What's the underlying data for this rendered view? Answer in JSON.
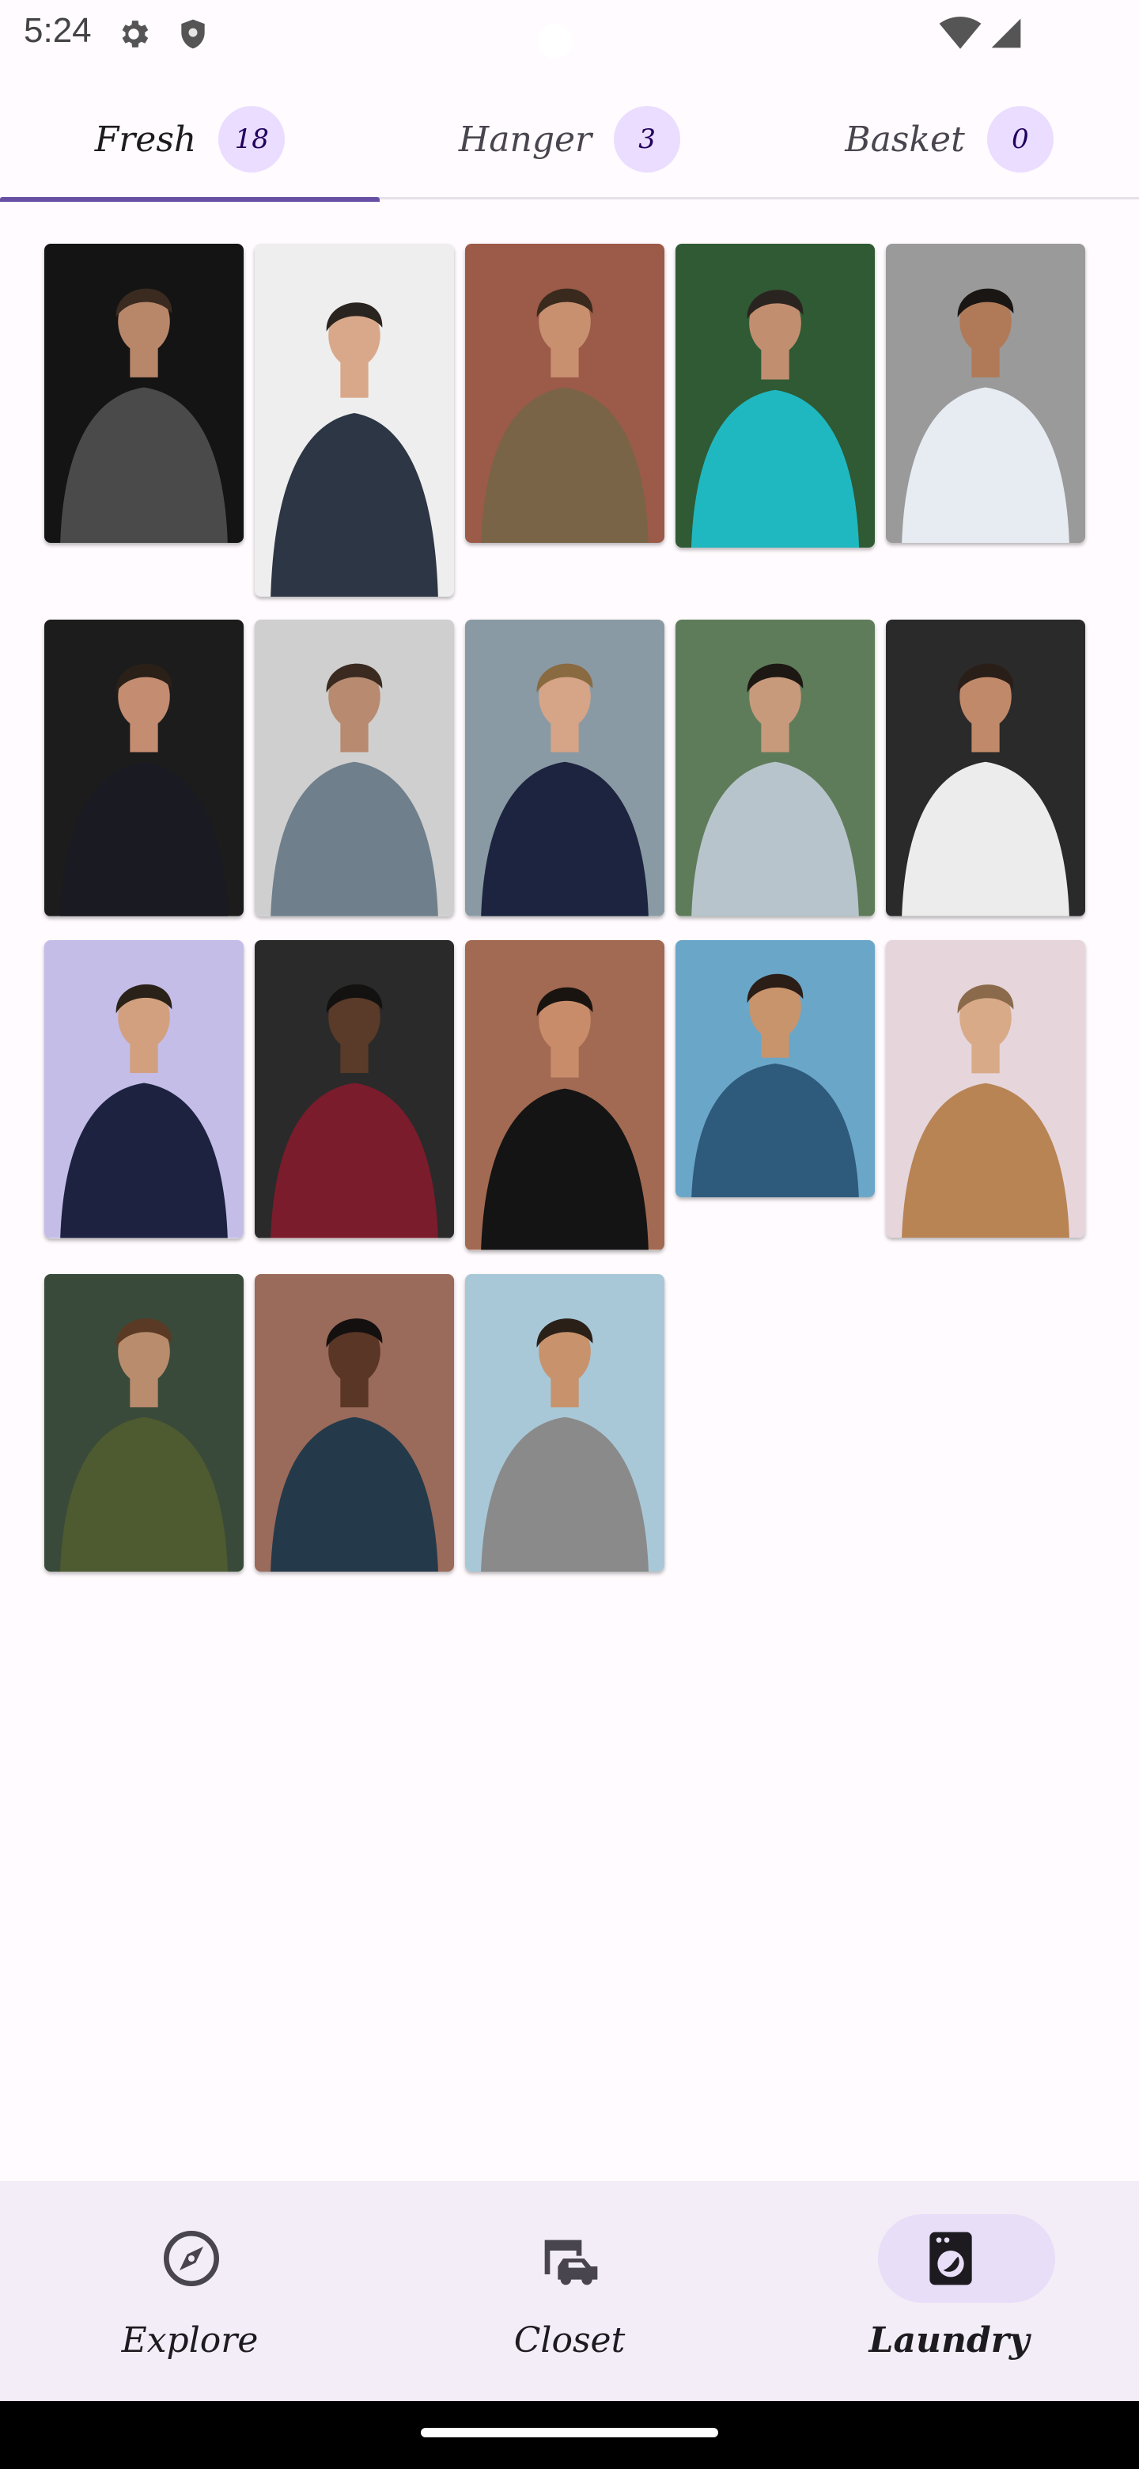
{
  "status_bar": {
    "time": "5:24",
    "left_icons": [
      "gear-icon",
      "shield-icon"
    ],
    "right_icons": [
      "wifi-icon",
      "cell-signal-icon"
    ]
  },
  "tabs": [
    {
      "label": "Fresh",
      "count": "18",
      "selected": true
    },
    {
      "label": "Hanger",
      "count": "3",
      "selected": false
    },
    {
      "label": "Basket",
      "count": "0",
      "selected": false
    }
  ],
  "photos": [
    {
      "name": "man-grey-knit-sweater",
      "bg": "#141414",
      "skin": "#b8876a",
      "hair": "#3a2a20",
      "shirt": "#4a4a4a"
    },
    {
      "name": "man-glasses-arms-crossed",
      "bg": "#eeeeee",
      "skin": "#d9a88a",
      "hair": "#2a2420",
      "shirt": "#2c3644"
    },
    {
      "name": "man-brown-jacket-brick-wall",
      "bg": "#9c5a48",
      "skin": "#c99070",
      "hair": "#3a2a1e",
      "shirt": "#7a6448"
    },
    {
      "name": "man-teal-shirt-plants",
      "bg": "#2f5a34",
      "skin": "#c28e70",
      "hair": "#2a2420",
      "shirt": "#1fb8c0"
    },
    {
      "name": "man-smiling-white-tee",
      "bg": "#9a9a9a",
      "skin": "#b07a58",
      "hair": "#1a1614",
      "shirt": "#e6ecf2"
    },
    {
      "name": "man-dark-suit-red-tie",
      "bg": "#1c1c1c",
      "skin": "#c48c70",
      "hair": "#2a2018",
      "shirt": "#1a1a22"
    },
    {
      "name": "man-skateboarding-beach",
      "bg": "#cfcfcf",
      "skin": "#b88a70",
      "hair": "#3a2a20",
      "shirt": "#6f7f8c"
    },
    {
      "name": "man-navy-suit-walkway",
      "bg": "#8a9aa4",
      "skin": "#d6a486",
      "hair": "#8a6a40",
      "shirt": "#1c2440"
    },
    {
      "name": "man-grey-tee-outdoors",
      "bg": "#5f7c5a",
      "skin": "#c89a7c",
      "hair": "#1e1814",
      "shirt": "#b8c4cc"
    },
    {
      "name": "man-white-tee-dark-backdrop",
      "bg": "#2a2a2a",
      "skin": "#c08a6a",
      "hair": "#2a1e18",
      "shirt": "#ececec"
    },
    {
      "name": "man-navy-shirt-lavender",
      "bg": "#c4bde8",
      "skin": "#d2a07e",
      "hair": "#2a2218",
      "shirt": "#1c2240"
    },
    {
      "name": "man-red-sweater-sunglasses",
      "bg": "#2a2a2a",
      "skin": "#5a3a28",
      "hair": "#141210",
      "shirt": "#7a1c2c"
    },
    {
      "name": "man-black-suit-street",
      "bg": "#a26a52",
      "skin": "#c88c6a",
      "hair": "#1a1410",
      "shirt": "#141414"
    },
    {
      "name": "man-denim-jacket-city",
      "bg": "#6aa6c8",
      "skin": "#c8946c",
      "hair": "#2a1e16",
      "shirt": "#2e5a7c"
    },
    {
      "name": "man-tan-blazer-stool",
      "bg": "#e6d6dc",
      "skin": "#d8aa88",
      "hair": "#8a6a4a",
      "shirt": "#b88454"
    },
    {
      "name": "man-olive-tee-beard",
      "bg": "#3a4a3a",
      "skin": "#b88c6c",
      "hair": "#5a3a24",
      "shirt": "#4e5a30"
    },
    {
      "name": "man-laughing-patterned-shirt",
      "bg": "#9a6a5a",
      "skin": "#5a3626",
      "hair": "#141010",
      "shirt": "#243a4a"
    },
    {
      "name": "man-sitting-rocks-backpack",
      "bg": "#a8c8d8",
      "skin": "#c8926c",
      "hair": "#2a2018",
      "shirt": "#8a8a8a"
    }
  ],
  "bottom_nav": [
    {
      "label": "Explore",
      "icon": "compass-icon",
      "active": false
    },
    {
      "label": "Closet",
      "icon": "wardrobe-cart-icon",
      "active": false
    },
    {
      "label": "Laundry",
      "icon": "washing-machine-icon",
      "active": true
    }
  ],
  "colors": {
    "accent": "#6750a4",
    "badge": "#eaddff",
    "nav_background": "#f3edf7",
    "nav_active_pill": "#e8def8"
  }
}
